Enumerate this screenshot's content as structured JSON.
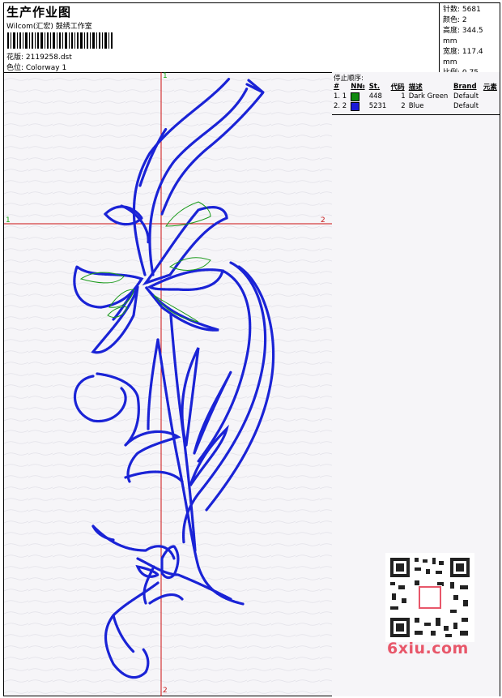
{
  "header": {
    "title": "生产作业图",
    "studio": "Wilcom(汇宏) 鼓绣工作室",
    "design_label": "花版: 2119258.dst",
    "colorway_label": "色位: Colorway 1"
  },
  "stats": {
    "stitches": "针数: 5681",
    "colors": "颜色: 2",
    "height": "高度: 344.5 mm",
    "width": "宽度: 117.4 mm",
    "scale": "比例: 0.75"
  },
  "stop_sequence": {
    "title": "停止顺序:",
    "columns": [
      "#",
      "N№",
      "St.",
      "代码",
      "描述",
      "Brand",
      "元素"
    ],
    "rows": [
      {
        "idx": "1. 1",
        "stitches": "448",
        "code": "1",
        "desc": "Dark Green",
        "brand": "Default",
        "color": "#118a11"
      },
      {
        "idx": "2. 2",
        "stitches": "5231",
        "code": "2",
        "desc": "Blue",
        "brand": "Default",
        "color": "#1a1ad8"
      }
    ]
  },
  "axis": {
    "top": "1",
    "bottom": "2",
    "left": "1",
    "right": "2"
  },
  "watermark": "6xiu.com",
  "colors": {
    "thread_blue": "#1a23d6",
    "thread_green": "#1a9a1a",
    "crosshair": "#cc1010"
  }
}
